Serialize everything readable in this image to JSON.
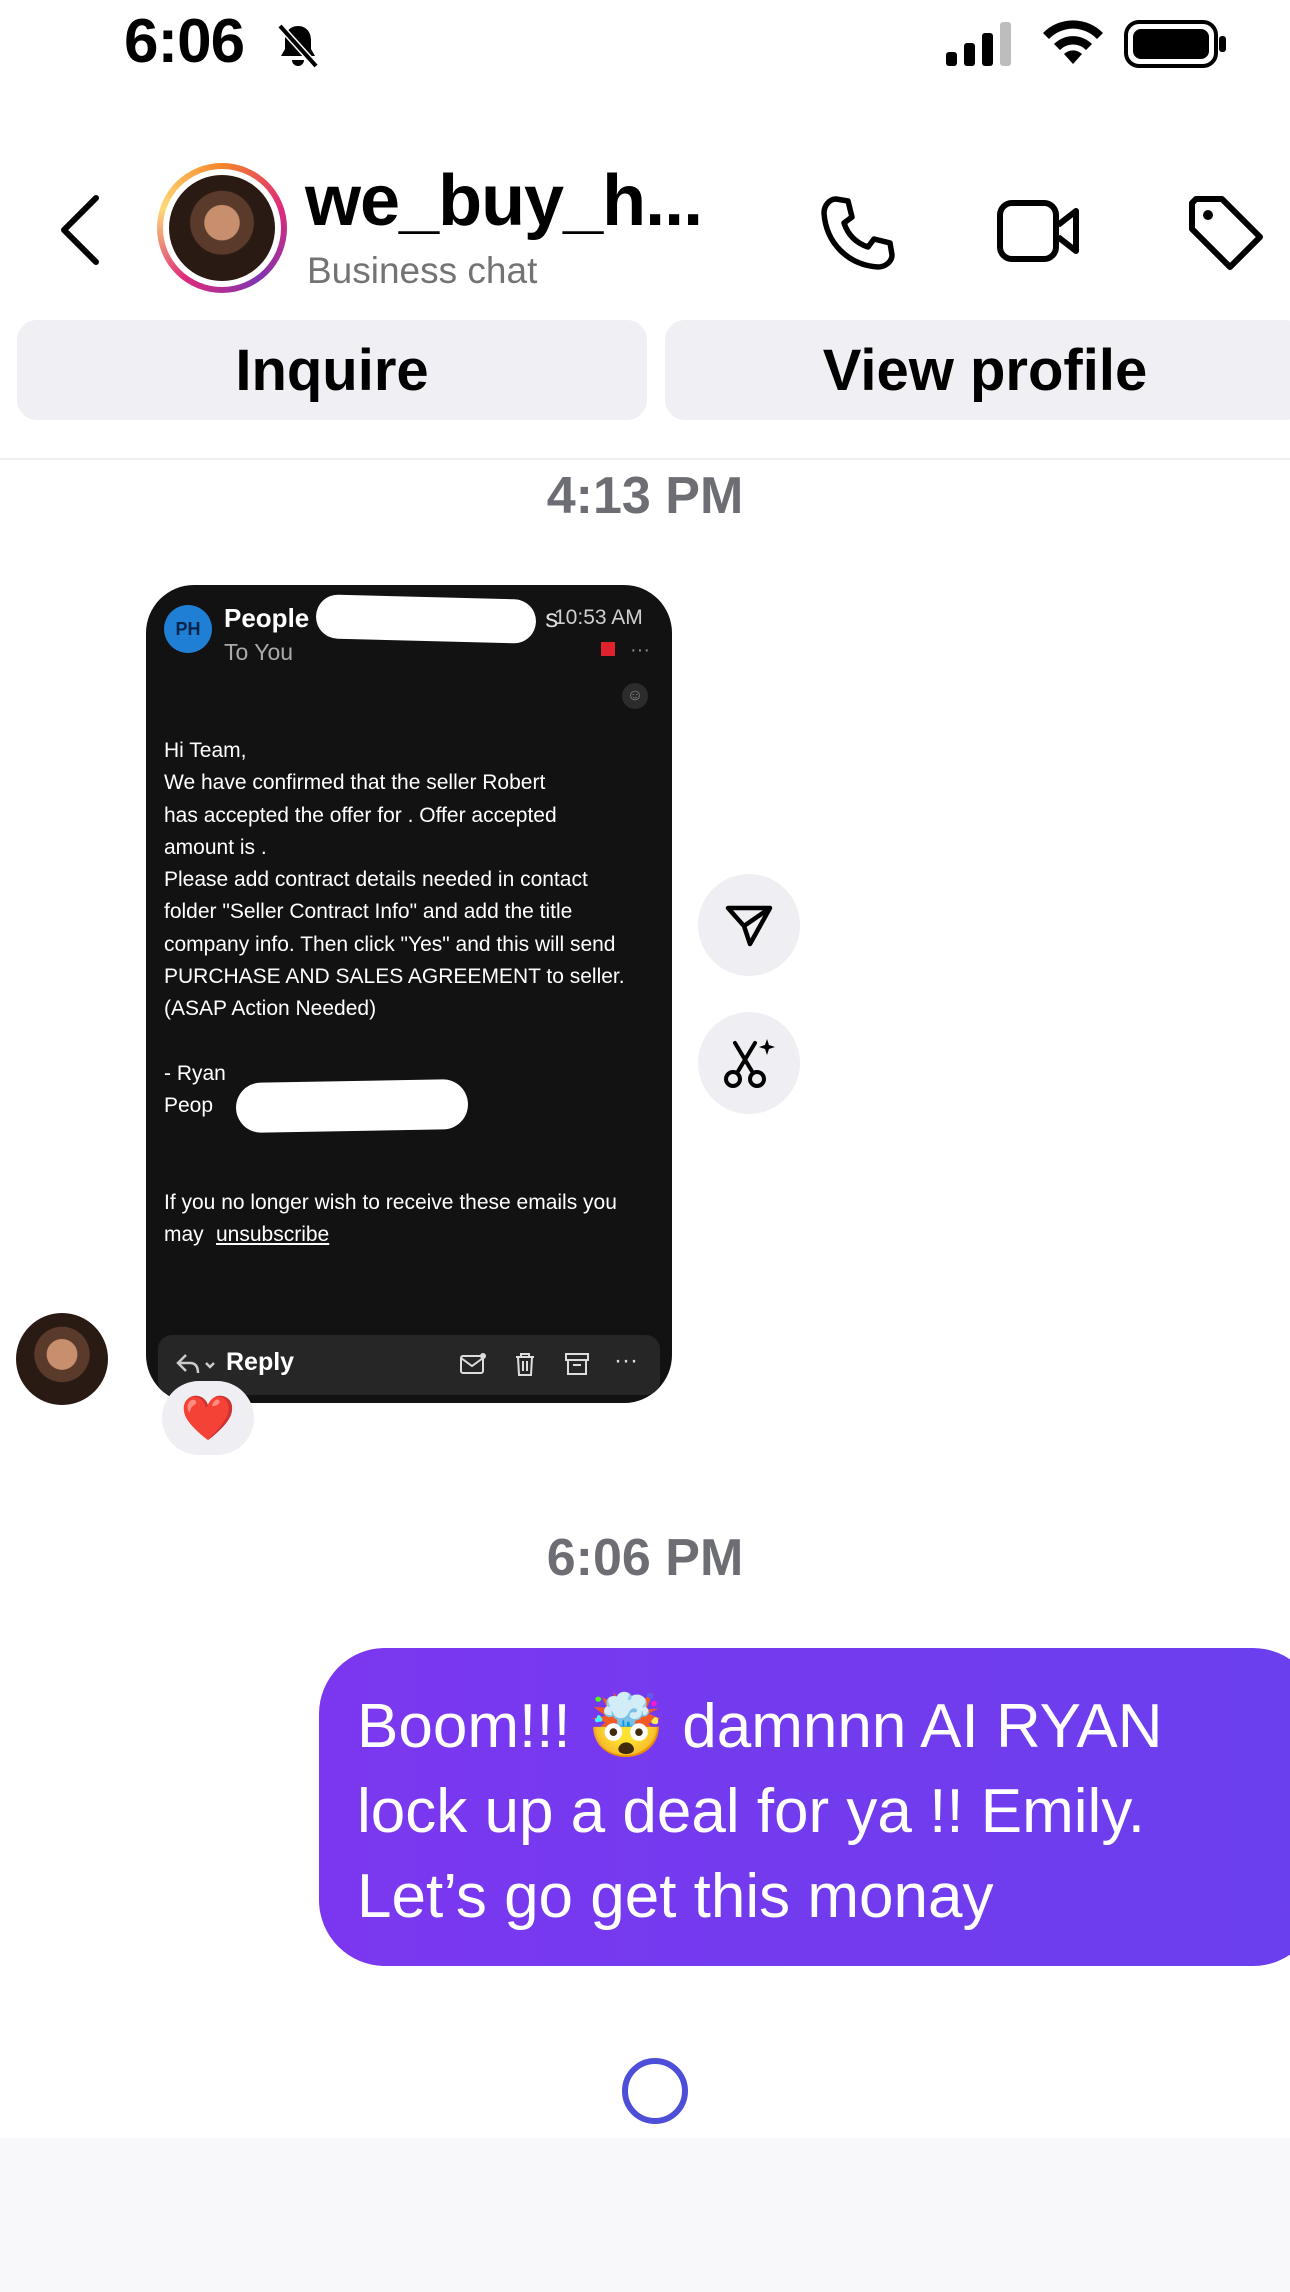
{
  "status_bar": {
    "time": "6:06",
    "icons": [
      "bell-slash-icon",
      "signal-icon",
      "wifi-icon",
      "battery-icon"
    ]
  },
  "header": {
    "contact_name": "we_buy_h...",
    "subtitle": "Business chat",
    "icons": [
      "back-icon",
      "phone-icon",
      "video-icon",
      "tag-icon"
    ]
  },
  "actions": {
    "inquire": "Inquire",
    "view_profile": "View profile"
  },
  "timestamps": {
    "first": "4:13 PM",
    "second": "6:06 PM"
  },
  "email": {
    "avatar_initials": "PH",
    "sender": "People",
    "sender_trailing": "s",
    "time": "10:53 AM",
    "to": "To You",
    "more_dots": "···",
    "body_lines": [
      "Hi Team,",
      "We have confirmed that the seller Robert",
      "has accepted the offer for . Offer accepted",
      "amount is .",
      "Please add contract details needed in contact",
      "folder \"Seller Contract Info\" and add the title",
      "company info. Then click \"Yes\" and this will send",
      "PURCHASE AND SALES AGREEMENT to seller.",
      "(ASAP Action Needed)"
    ],
    "signature_name": "- Ryan",
    "signature_company": "Peop",
    "footer_text": "If you no longer wish to receive these emails you may",
    "unsubscribe": "unsubscribe",
    "reply_label": "Reply",
    "more_label": "···"
  },
  "reaction": "❤️",
  "outgoing_message": "Boom!!! 🤯 damnnn AI RYAN lock up a deal for ya !! Emily. Let’s go get this monay",
  "colors": {
    "outgoing_bubble": "#7035ef",
    "timestamp": "#6d6d74",
    "pill_bg": "#efeff4",
    "spinner": "#4e4fd8"
  }
}
